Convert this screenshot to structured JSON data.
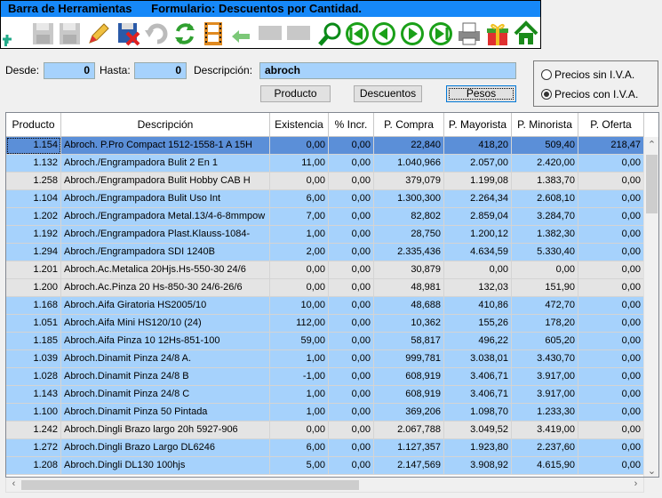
{
  "toolbar": {
    "title": "Barra de Herramientas      Formulario: Descuentos por Cantidad.",
    "icons": [
      "add-icon",
      "disk-icon",
      "disk-icon",
      "pencil-icon",
      "save-cancel-icon",
      "undo-icon",
      "refresh-icon",
      "film-icon",
      "back-arrow-icon",
      "blank-icon",
      "blank-icon",
      "search-icon",
      "first-icon",
      "prev-icon",
      "next-icon",
      "last-icon",
      "printer-icon",
      "gift-icon",
      "home-icon"
    ]
  },
  "filters": {
    "desde_label": "Desde:",
    "desde_value": "0",
    "hasta_label": "Hasta:",
    "hasta_value": "0",
    "descripcion_label": "Descripción:",
    "descripcion_value": "abroch"
  },
  "buttons": {
    "producto": "Producto",
    "descuentos": "Descuentos",
    "pesos": "Pesos"
  },
  "iva": {
    "sin": "Precios sin I.V.A.",
    "con": "Precios con I.V.A.",
    "selected": "con"
  },
  "columns": [
    "Producto",
    "Descripción",
    "Existencia",
    "% Incr.",
    "P. Compra",
    "P. Mayorista",
    "P. Minorista",
    "P. Oferta"
  ],
  "rows": [
    [
      "1.154",
      "Abroch. P.Pro Compact 1512-1558-1 A 15H",
      "0,00",
      "0,00",
      "22,840",
      "418,20",
      "509,40",
      "218,47"
    ],
    [
      "1.132",
      "Abroch./Engrampadora Bulit  2 En 1",
      "11,00",
      "0,00",
      "1.040,966",
      "2.057,00",
      "2.420,00",
      "0,00"
    ],
    [
      "1.258",
      "Abroch./Engrampadora Bulit Hobby CAB H",
      "0,00",
      "0,00",
      "379,079",
      "1.199,08",
      "1.383,70",
      "0,00"
    ],
    [
      "1.104",
      "Abroch./Engrampadora Bulit Uso Int",
      "6,00",
      "0,00",
      "1.300,300",
      "2.264,34",
      "2.608,10",
      "0,00"
    ],
    [
      "1.202",
      "Abroch./Engrampadora Metal.13/4-6-8mmpow",
      "7,00",
      "0,00",
      "82,802",
      "2.859,04",
      "3.284,70",
      "0,00"
    ],
    [
      "1.192",
      "Abroch./Engrampadora Plast.Klauss-1084-",
      "1,00",
      "0,00",
      "28,750",
      "1.200,12",
      "1.382,30",
      "0,00"
    ],
    [
      "1.294",
      "Abroch./Engrampadora SDI 1240B",
      "2,00",
      "0,00",
      "2.335,436",
      "4.634,59",
      "5.330,40",
      "0,00"
    ],
    [
      "1.201",
      "Abroch.Ac.Metalica 20Hjs.Hs-550-30 24/6",
      "0,00",
      "0,00",
      "30,879",
      "0,00",
      "0,00",
      "0,00"
    ],
    [
      "1.200",
      "Abroch.Ac.Pinza 20 Hs-850-30 24/6-26/6",
      "0,00",
      "0,00",
      "48,981",
      "132,03",
      "151,90",
      "0,00"
    ],
    [
      "1.168",
      "Abroch.Aifa Giratoria HS2005/10",
      "10,00",
      "0,00",
      "48,688",
      "410,86",
      "472,70",
      "0,00"
    ],
    [
      "1.051",
      "Abroch.Aifa Mini HS120/10 (24)",
      "112,00",
      "0,00",
      "10,362",
      "155,26",
      "178,20",
      "0,00"
    ],
    [
      "1.185",
      "Abroch.Aifa Pinza 10 12Hs-851-100",
      "59,00",
      "0,00",
      "58,817",
      "496,22",
      "605,20",
      "0,00"
    ],
    [
      "1.039",
      "Abroch.Dinamit Pinza 24/8 A.",
      "1,00",
      "0,00",
      "999,781",
      "3.038,01",
      "3.430,70",
      "0,00"
    ],
    [
      "1.028",
      "Abroch.Dinamit Pinza 24/8 B",
      "-1,00",
      "0,00",
      "608,919",
      "3.406,71",
      "3.917,00",
      "0,00"
    ],
    [
      "1.143",
      "Abroch.Dinamit Pinza 24/8 C",
      "1,00",
      "0,00",
      "608,919",
      "3.406,71",
      "3.917,00",
      "0,00"
    ],
    [
      "1.100",
      "Abroch.Dinamit Pinza 50 Pintada",
      "1,00",
      "0,00",
      "369,206",
      "1.098,70",
      "1.233,30",
      "0,00"
    ],
    [
      "1.242",
      "Abroch.Dingli Brazo largo 20h 5927-906",
      "0,00",
      "0,00",
      "2.067,788",
      "3.049,52",
      "3.419,00",
      "0,00"
    ],
    [
      "1.272",
      "Abroch.Dingli Brazo Largo DL6246",
      "6,00",
      "0,00",
      "1.127,357",
      "1.923,80",
      "2.237,60",
      "0,00"
    ],
    [
      "1.208",
      "Abroch.Dingli DL130 100hjs",
      "5,00",
      "0,00",
      "2.147,569",
      "3.908,92",
      "4.615,90",
      "0,00"
    ]
  ],
  "row_styles": [
    "sel",
    "blue",
    "gray",
    "blue",
    "blue",
    "blue",
    "blue",
    "gray",
    "gray",
    "blue",
    "blue",
    "blue",
    "blue",
    "blue",
    "blue",
    "blue",
    "gray",
    "blue",
    "blue"
  ],
  "colors": {
    "title_bar": "#1688f8",
    "input_bg": "#a6d2fc",
    "row_blue": "#a6d2fc",
    "row_gray": "#e4e4e4",
    "row_selected": "#5b8fd8"
  }
}
